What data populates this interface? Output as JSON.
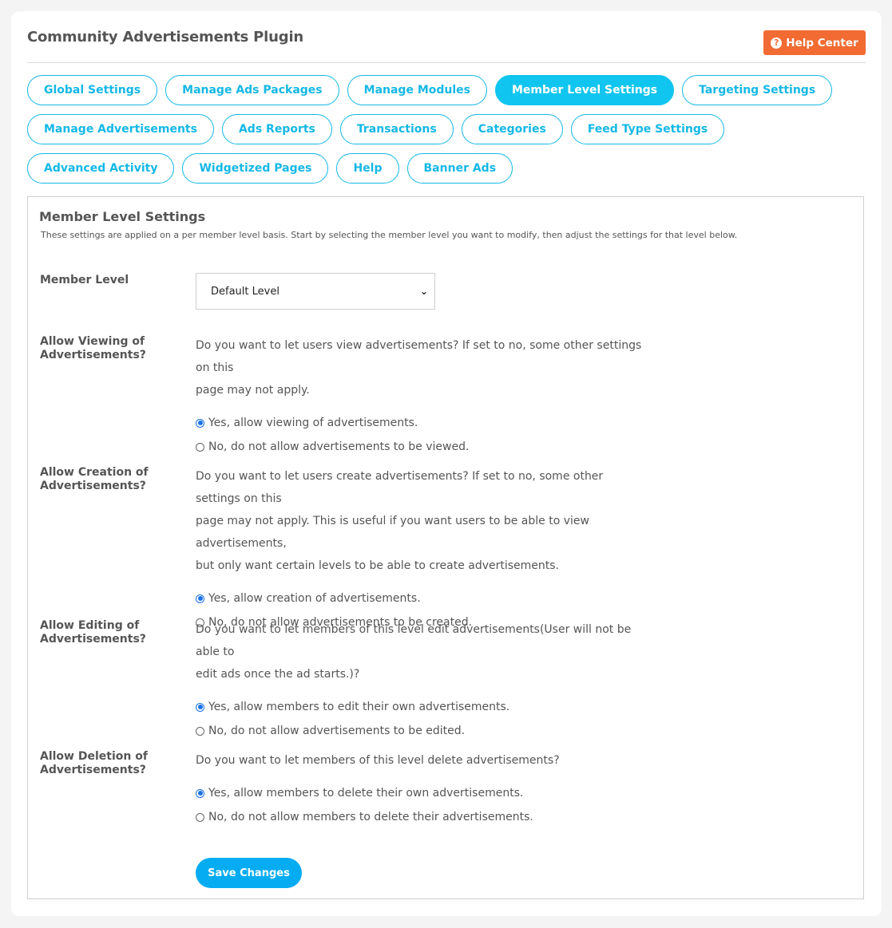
{
  "header": {
    "title": "Community Advertisements Plugin",
    "help_button": {
      "label": "Help Center",
      "icon": "question-circle-icon"
    }
  },
  "tabs": [
    {
      "label": "Global Settings",
      "active": false
    },
    {
      "label": "Manage Ads Packages",
      "active": false
    },
    {
      "label": "Manage Modules",
      "active": false
    },
    {
      "label": "Member Level Settings",
      "active": true
    },
    {
      "label": "Targeting Settings",
      "active": false
    },
    {
      "label": "Manage Advertisements",
      "active": false
    },
    {
      "label": "Ads Reports",
      "active": false
    },
    {
      "label": "Transactions",
      "active": false
    },
    {
      "label": "Categories",
      "active": false
    },
    {
      "label": "Feed Type Settings",
      "active": false
    },
    {
      "label": "Advanced Activity",
      "active": false
    },
    {
      "label": "Widgetized Pages",
      "active": false
    },
    {
      "label": "Help",
      "active": false
    },
    {
      "label": "Banner Ads",
      "active": false
    }
  ],
  "panel": {
    "title": "Member Level Settings",
    "description": "These settings are applied on a per member level basis. Start by selecting the member level you want to modify, then adjust the settings for that level below.",
    "member_level": {
      "label": "Member Level",
      "selected": "Default Level"
    },
    "settings": [
      {
        "label_line1": "Allow Viewing of",
        "label_line2": "Advertisements?",
        "desc_lines": [
          "Do you want to let users view advertisements? If set to no, some other settings on this",
          "page may not apply."
        ],
        "options": [
          {
            "label": "Yes, allow viewing of advertisements.",
            "checked": true
          },
          {
            "label": "No, do not allow advertisements to be viewed.",
            "checked": false
          }
        ]
      },
      {
        "label_line1": "Allow Creation of",
        "label_line2": "Advertisements?",
        "desc_lines": [
          "Do you want to let users create advertisements? If set to no, some other settings on this",
          "page may not apply. This is useful if you want users to be able to view advertisements,",
          "but only want certain levels to be able to create advertisements."
        ],
        "options": [
          {
            "label": "Yes, allow creation of advertisements.",
            "checked": true
          },
          {
            "label": "No, do not allow advertisements to be created.",
            "checked": false
          }
        ]
      },
      {
        "label_line1": "Allow Editing of",
        "label_line2": "Advertisements?",
        "desc_lines": [
          "Do you want to let members of this level edit advertisements(User will not be able to",
          "edit ads once the ad starts.)?"
        ],
        "options": [
          {
            "label": "Yes, allow members to edit their own advertisements.",
            "checked": true
          },
          {
            "label": "No, do not allow advertisements to be edited.",
            "checked": false
          }
        ]
      },
      {
        "label_line1": "Allow Deletion of",
        "label_line2": "Advertisements?",
        "desc_lines": [
          "Do you want to let members of this level delete advertisements?"
        ],
        "options": [
          {
            "label": "Yes, allow members to delete their own advertisements.",
            "checked": true
          },
          {
            "label": "No, do not allow members to delete their advertisements.",
            "checked": false
          }
        ]
      }
    ],
    "save_label": "Save Changes"
  },
  "colors": {
    "accent": "#10c5ef",
    "help_button": "#f26b32",
    "save_button": "#06acf2",
    "radio_checked": "#1a73e8"
  }
}
